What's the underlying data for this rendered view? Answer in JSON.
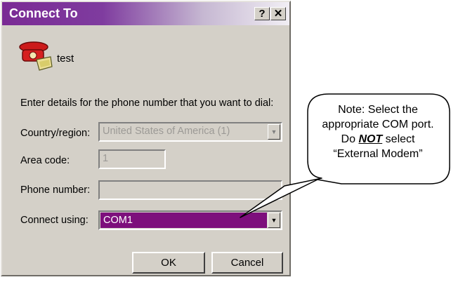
{
  "dialog": {
    "title": "Connect To",
    "help_button": "?",
    "close_button": "✕",
    "connection_name": "test",
    "instructions": "Enter details for the phone number that you want to dial:",
    "country_label": "Country/region:",
    "country_value": "United States of America (1)",
    "area_code_label": "Area code:",
    "area_code_value": "1",
    "phone_label": "Phone number:",
    "phone_value": "",
    "connect_label": "Connect using:",
    "connect_value": "COM1",
    "ok_label": "OK",
    "cancel_label": "Cancel"
  },
  "callout": {
    "line1": "Note: Select the",
    "line2": "appropriate COM port.",
    "line3_prefix": "Do ",
    "line3_emphasis": "NOT",
    "line3_suffix": " select",
    "line4": "“External Modem”"
  },
  "colors": {
    "title_bar": "#7a2a94",
    "selection": "#7d0f7c",
    "dialog_face": "#d4d0c8"
  }
}
